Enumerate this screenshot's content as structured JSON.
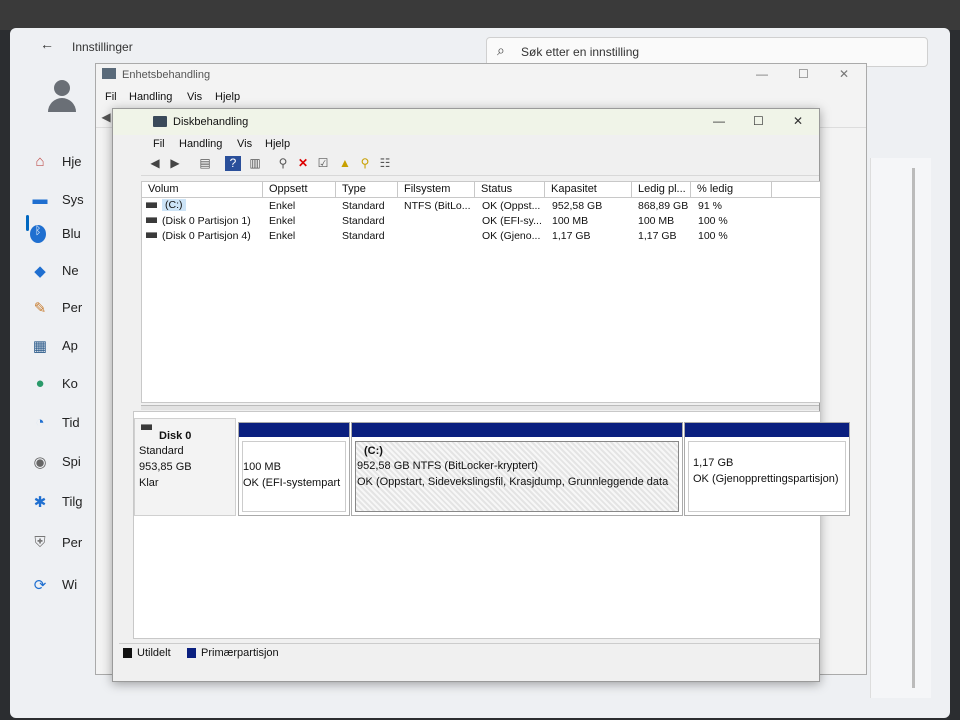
{
  "settings": {
    "title": "Innstillinger",
    "search_placeholder": "Søk etter en innstilling",
    "nav": [
      {
        "label": "Hje",
        "icon": "home-icon"
      },
      {
        "label": "Sys",
        "icon": "system-icon"
      },
      {
        "label": "Blu",
        "icon": "bluetooth-icon"
      },
      {
        "label": "Ne",
        "icon": "network-icon"
      },
      {
        "label": "Per",
        "icon": "personalization-icon"
      },
      {
        "label": "Ap",
        "icon": "apps-icon"
      },
      {
        "label": "Ko",
        "icon": "accounts-icon"
      },
      {
        "label": "Tid",
        "icon": "time-icon"
      },
      {
        "label": "Spi",
        "icon": "gaming-icon"
      },
      {
        "label": "Tilg",
        "icon": "accessibility-icon"
      },
      {
        "label": "Per",
        "icon": "privacy-icon"
      },
      {
        "label": "Wi",
        "icon": "windows-update-icon"
      }
    ]
  },
  "device_manager": {
    "title": "Enhetsbehandling",
    "menu": [
      "Fil",
      "Handling",
      "Vis",
      "Hjelp"
    ]
  },
  "disk_management": {
    "title": "Diskbehandling",
    "menu": [
      "Fil",
      "Handling",
      "Vis",
      "Hjelp"
    ],
    "columns": [
      "Volum",
      "Oppsett",
      "Type",
      "Filsystem",
      "Status",
      "Kapasitet",
      "Ledig pl...",
      "% ledig"
    ],
    "rows": [
      {
        "volum": "(C:)",
        "oppsett": "Enkel",
        "type": "Standard",
        "filsystem": "NTFS (BitLo...",
        "status": "OK (Oppst...",
        "kapasitet": "952,58 GB",
        "ledig": "868,89 GB",
        "prosent": "91 %"
      },
      {
        "volum": "(Disk 0 Partisjon 1)",
        "oppsett": "Enkel",
        "type": "Standard",
        "filsystem": "",
        "status": "OK (EFI-sy...",
        "kapasitet": "100 MB",
        "ledig": "100 MB",
        "prosent": "100 %"
      },
      {
        "volum": "(Disk 0 Partisjon 4)",
        "oppsett": "Enkel",
        "type": "Standard",
        "filsystem": "",
        "status": "OK (Gjeno...",
        "kapasitet": "1,17 GB",
        "ledig": "1,17 GB",
        "prosent": "100 %"
      }
    ],
    "disk": {
      "name": "Disk 0",
      "type": "Standard",
      "size": "953,85 GB",
      "state": "Klar",
      "partitions": [
        {
          "title": "",
          "size": "100 MB",
          "status": "OK (EFI-systempart"
        },
        {
          "title": "(C:)",
          "size": "952,58 GB NTFS (BitLocker-kryptert)",
          "status": "OK (Oppstart, Sidevekslingsfil, Krasjdump, Grunnleggende data"
        },
        {
          "title": "",
          "size": "1,17 GB",
          "status": "OK (Gjenopprettingspartisjon)"
        }
      ]
    },
    "legend": [
      {
        "label": "Utildelt",
        "color": "#111111"
      },
      {
        "label": "Primærpartisjon",
        "color": "#0a1f7f"
      }
    ]
  }
}
